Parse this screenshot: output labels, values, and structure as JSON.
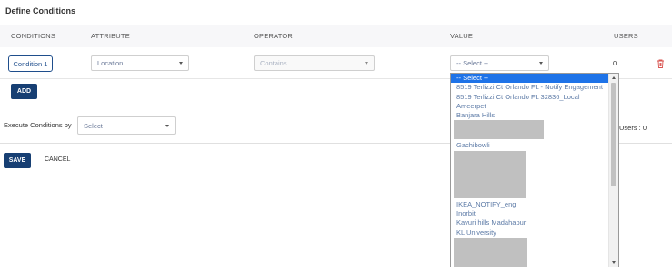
{
  "page": {
    "title": "Define Conditions"
  },
  "table": {
    "headers": {
      "conditions": "CONDITIONS",
      "attribute": "ATTRIBUTE",
      "operator": "OPERATOR",
      "value": "VALUE",
      "users": "USERS"
    },
    "row": {
      "condition_label": "Condition 1",
      "attribute": "Location",
      "operator": "Contains",
      "value": "-- Select --",
      "users": "0"
    }
  },
  "add_label": "ADD",
  "execute": {
    "label": "Execute Conditions by",
    "placeholder": "Select"
  },
  "users_summary": "Users : 0",
  "actions": {
    "save": "SAVE",
    "cancel": "CANCEL"
  },
  "value_dropdown": {
    "options": [
      "-- Select --",
      "8519 Terlizzi Ct Orlando FL - Notify Engagement",
      "8519 Terlizzi Ct Orlando FL 32836_Local",
      "Ameerpet",
      "Banjara Hills",
      "Gachibowli",
      "IKEA_NOTIFY_eng",
      "Inorbit",
      "Kavuri hills Madahapur",
      "KL University"
    ]
  },
  "colors": {
    "primary": "#173f73",
    "selected_option": "#1e73e8",
    "option_text": "#5c7aa6",
    "delete_icon": "#d9534f"
  }
}
